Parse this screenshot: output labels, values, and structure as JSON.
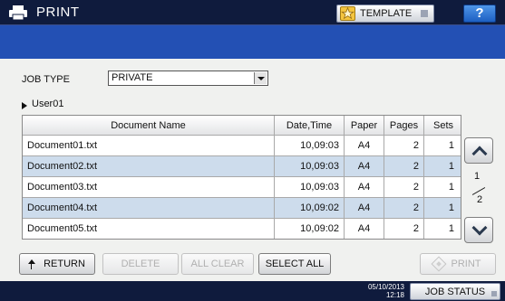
{
  "header": {
    "title": "PRINT",
    "template_label": "TEMPLATE",
    "help_label": "?"
  },
  "job_type": {
    "label": "JOB TYPE",
    "selected": "PRIVATE"
  },
  "user": "User01",
  "table": {
    "columns": [
      "Document Name",
      "Date,Time",
      "Paper",
      "Pages",
      "Sets"
    ],
    "rows": [
      {
        "name": "Document01.txt",
        "datetime": "10,09:03",
        "paper": "A4",
        "pages": "2",
        "sets": "1"
      },
      {
        "name": "Document02.txt",
        "datetime": "10,09:03",
        "paper": "A4",
        "pages": "2",
        "sets": "1"
      },
      {
        "name": "Document03.txt",
        "datetime": "10,09:03",
        "paper": "A4",
        "pages": "2",
        "sets": "1"
      },
      {
        "name": "Document04.txt",
        "datetime": "10,09:02",
        "paper": "A4",
        "pages": "2",
        "sets": "1"
      },
      {
        "name": "Document05.txt",
        "datetime": "10,09:02",
        "paper": "A4",
        "pages": "2",
        "sets": "1"
      }
    ]
  },
  "pagination": {
    "current": "1",
    "total": "2"
  },
  "buttons": {
    "return": "RETURN",
    "delete": "DELETE",
    "all_clear": "ALL CLEAR",
    "select_all": "SELECT ALL",
    "print": "PRINT"
  },
  "footer": {
    "date": "05/10/2013",
    "time": "12:18",
    "job_status": "JOB STATUS"
  },
  "colors": {
    "titlebar": "#0f1b3d",
    "band": "#2350b4",
    "row_alt": "#cddcec"
  }
}
